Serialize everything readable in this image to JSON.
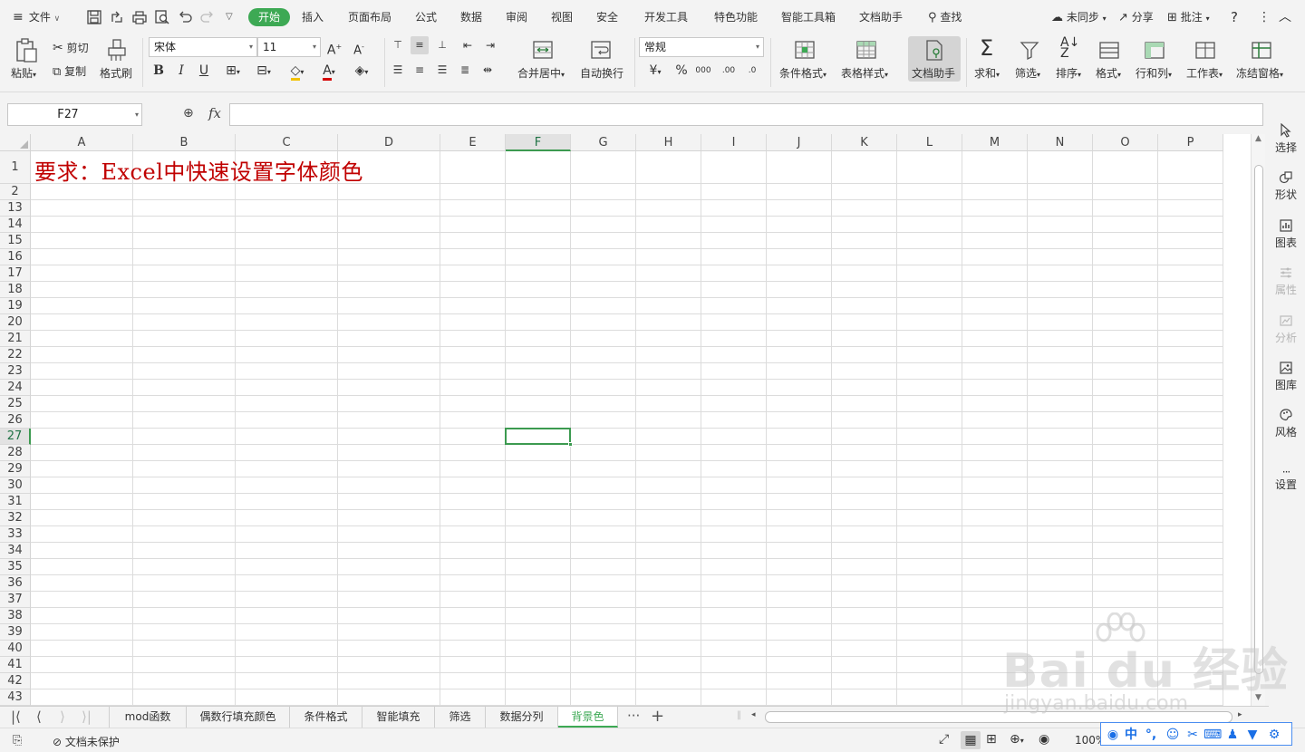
{
  "menubar": {
    "file_label": "文件",
    "tabs": [
      "开始",
      "插入",
      "页面布局",
      "公式",
      "数据",
      "审阅",
      "视图",
      "安全",
      "开发工具",
      "特色功能",
      "智能工具箱",
      "文档助手"
    ],
    "search_label": "查找",
    "sync_label": "未同步",
    "share_label": "分享",
    "comment_label": "批注"
  },
  "ribbon": {
    "paste_label": "粘贴",
    "cut_label": "剪切",
    "copy_label": "复制",
    "format_painter_label": "格式刷",
    "font_name": "宋体",
    "font_size": "11",
    "merge_label": "合并居中",
    "wrap_label": "自动换行",
    "number_format": "常规",
    "cond_format_label": "条件格式",
    "table_style_label": "表格样式",
    "doc_helper_label": "文档助手",
    "sum_label": "求和",
    "filter_label": "筛选",
    "sort_label": "排序",
    "format_label": "格式",
    "rowcol_label": "行和列",
    "sheet_label": "工作表",
    "freeze_label": "冻结窗格"
  },
  "formula_bar": {
    "name_box": "F27",
    "fx_label": "fx",
    "formula": ""
  },
  "grid": {
    "columns": [
      "A",
      "B",
      "C",
      "D",
      "E",
      "F",
      "G",
      "H",
      "I",
      "J",
      "K",
      "L",
      "M",
      "N",
      "O",
      "P"
    ],
    "rows": [
      "1",
      "2",
      "13",
      "14",
      "15",
      "16",
      "17",
      "18",
      "19",
      "20",
      "21",
      "22",
      "23",
      "24",
      "25",
      "26",
      "27",
      "28",
      "29",
      "30",
      "31",
      "32",
      "33",
      "34",
      "35",
      "36",
      "37",
      "38",
      "39",
      "40",
      "41",
      "42",
      "43"
    ],
    "selected_column": "F",
    "selected_row": "27",
    "a1_text": "要求：Excel中快速设置字体颜色"
  },
  "side_panel": {
    "items": [
      "选择",
      "形状",
      "图表",
      "属性",
      "分析",
      "图库",
      "风格",
      "设置"
    ]
  },
  "sheet_tabs": {
    "tabs": [
      "mod函数",
      "偶数行填充颜色",
      "条件格式",
      "智能填充",
      "筛选",
      "数据分列",
      "背景色"
    ],
    "active": "背景色",
    "more": "···",
    "add": "+"
  },
  "status_bar": {
    "protect_label": "文档未保护",
    "zoom_label": "100%"
  },
  "watermark": {
    "main": "Bai du 经验",
    "sub": "jingyan.baidu.com"
  },
  "ime": {
    "lang": "中"
  },
  "colors": {
    "accent": "#3da954",
    "a1_text": "#c00000",
    "selection": "#3c9a50"
  }
}
